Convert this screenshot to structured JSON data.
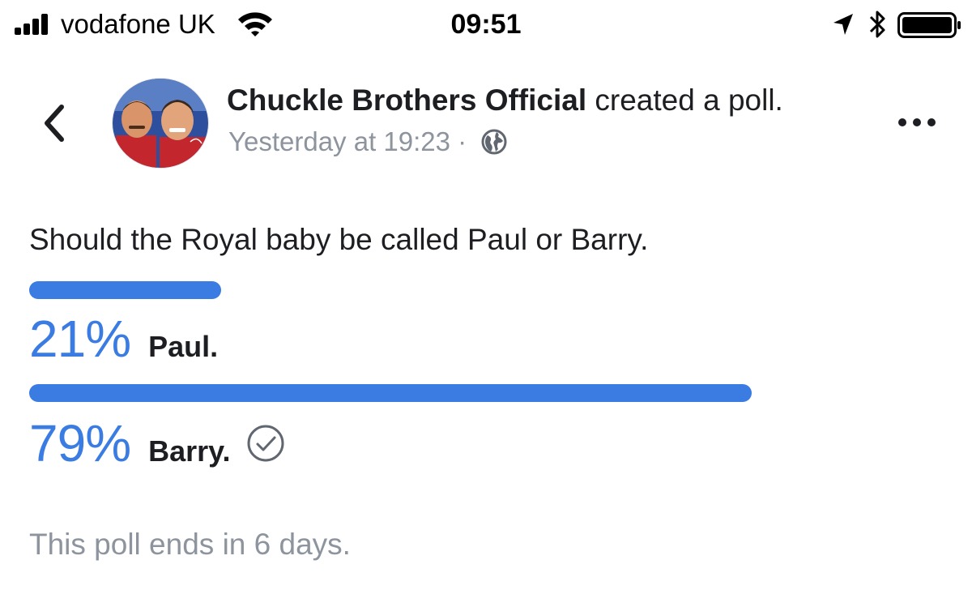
{
  "status_bar": {
    "carrier": "vodafone UK",
    "time": "09:51",
    "icons": [
      "signal-icon",
      "wifi-icon",
      "location-arrow-icon",
      "bluetooth-icon",
      "battery-icon"
    ]
  },
  "header": {
    "author": "Chuckle Brothers Official",
    "action": " created a poll.",
    "timestamp": "Yesterday at 19:23",
    "separator": " · ",
    "audience_icon": "globe-icon"
  },
  "poll": {
    "question": "Should the Royal baby be called Paul or Barry.",
    "options": [
      {
        "percent_label": "21%",
        "percent": 21,
        "label": "Paul.",
        "selected": false
      },
      {
        "percent_label": "79%",
        "percent": 79,
        "label": "Barry.",
        "selected": true
      }
    ],
    "footer": "This poll ends in 6 days."
  },
  "colors": {
    "accent": "#3b7ce3",
    "muted_text": "#8d949e",
    "text": "#1c1e21"
  }
}
